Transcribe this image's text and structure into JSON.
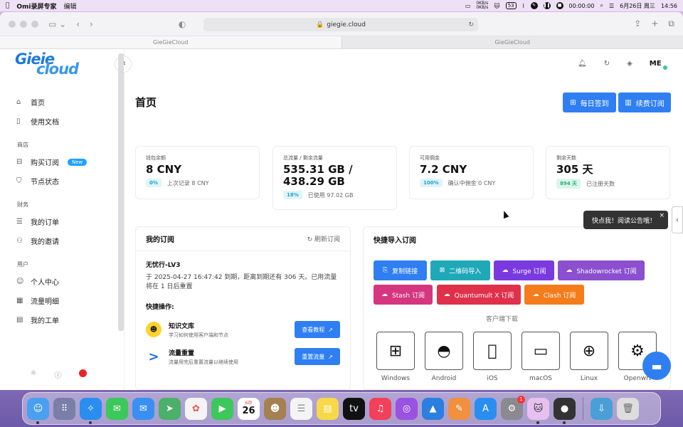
{
  "menubar": {
    "apple": "",
    "app_name": "Omi录屏专家",
    "menu_edit": "编辑",
    "net_up": "0KB/s",
    "net_down": "0KB/s",
    "battery": "53",
    "rec_time": "00:00:00",
    "datetime": "6月26日 周三",
    "clock": "14:56"
  },
  "browser": {
    "url": "giegie.cloud",
    "tabs": [
      "GieGieCloud",
      "GieGieCloud"
    ]
  },
  "logo": {
    "line1": "Gieie",
    "line2": "cloud"
  },
  "sidebar": {
    "items_top": [
      {
        "label": "首页",
        "icon": "home-icon"
      },
      {
        "label": "使用文档",
        "icon": "book-icon"
      }
    ],
    "section_shop": "商店",
    "items_shop": [
      {
        "label": "购买订阅",
        "icon": "bag-icon",
        "badge": "New"
      },
      {
        "label": "节点状态",
        "icon": "shield-icon"
      }
    ],
    "section_finance": "财务",
    "items_finance": [
      {
        "label": "我的订单",
        "icon": "list-icon"
      },
      {
        "label": "我的邀请",
        "icon": "users-icon"
      }
    ],
    "section_user": "用户",
    "items_user": [
      {
        "label": "个人中心",
        "icon": "user-icon"
      },
      {
        "label": "流量明细",
        "icon": "calendar-icon"
      },
      {
        "label": "我的工单",
        "icon": "ticket-icon"
      }
    ]
  },
  "header": {
    "avatar": "ME"
  },
  "page": {
    "title": "首页",
    "checkin_label": "每日签到",
    "renew_label": "续费订阅"
  },
  "stats": [
    {
      "label": "钱包余额",
      "value": "8 CNY",
      "chip": "0%",
      "sub": "上次记录 8 CNY"
    },
    {
      "label": "总流量 / 剩余流量",
      "value": "535.31 GB / 438.29 GB",
      "chip": "18%",
      "sub": "已使用 97.02 GB"
    },
    {
      "label": "可用佣金",
      "value": "7.2 CNY",
      "chip": "100%",
      "sub": "确认中佣金 0 CNY"
    },
    {
      "label": "剩余天数",
      "value": "305 天",
      "chip": "894 天",
      "sub": "已注册天数"
    }
  ],
  "subscription": {
    "title": "我的订阅",
    "refresh": "刷新订阅",
    "plan": "无忧行-LV3",
    "desc": "于 2025-04-27 16:47:42 到期，距离到期还有 306 天。已用流量将在 1 日后重置",
    "quick_title": "快捷操作:",
    "quick": [
      {
        "title": "知识文库",
        "desc": "学习如何使用客户端和节点",
        "button": "查看教程"
      },
      {
        "title": "流量重置",
        "desc": "流量用完后重置流量以继续使用",
        "button": "重置流量"
      }
    ]
  },
  "import": {
    "title": "快捷导入订阅",
    "buttons": [
      {
        "label": "复制链接",
        "color": "#2f7ff2"
      },
      {
        "label": "二维码导入",
        "color": "#1fa8b8"
      },
      {
        "label": "Surge 订阅",
        "color": "#7a3ae0"
      },
      {
        "label": "Shadowrocket 订阅",
        "color": "#8b4fd0"
      },
      {
        "label": "Stash 订阅",
        "color": "#d6357f"
      },
      {
        "label": "Quantumult X 订阅",
        "color": "#e0304a"
      },
      {
        "label": "Clash 订阅",
        "color": "#f57c1a"
      }
    ],
    "download_label": "客户端下载",
    "clients": [
      "Windows",
      "Android",
      "iOS",
      "macOS",
      "Linux",
      "Openwrt"
    ]
  },
  "tooltip": {
    "text": "快点我！阅读公告哦！",
    "close": "×"
  },
  "dock": {
    "calendar_month": "6月",
    "calendar_day": "26",
    "badge": "1"
  }
}
